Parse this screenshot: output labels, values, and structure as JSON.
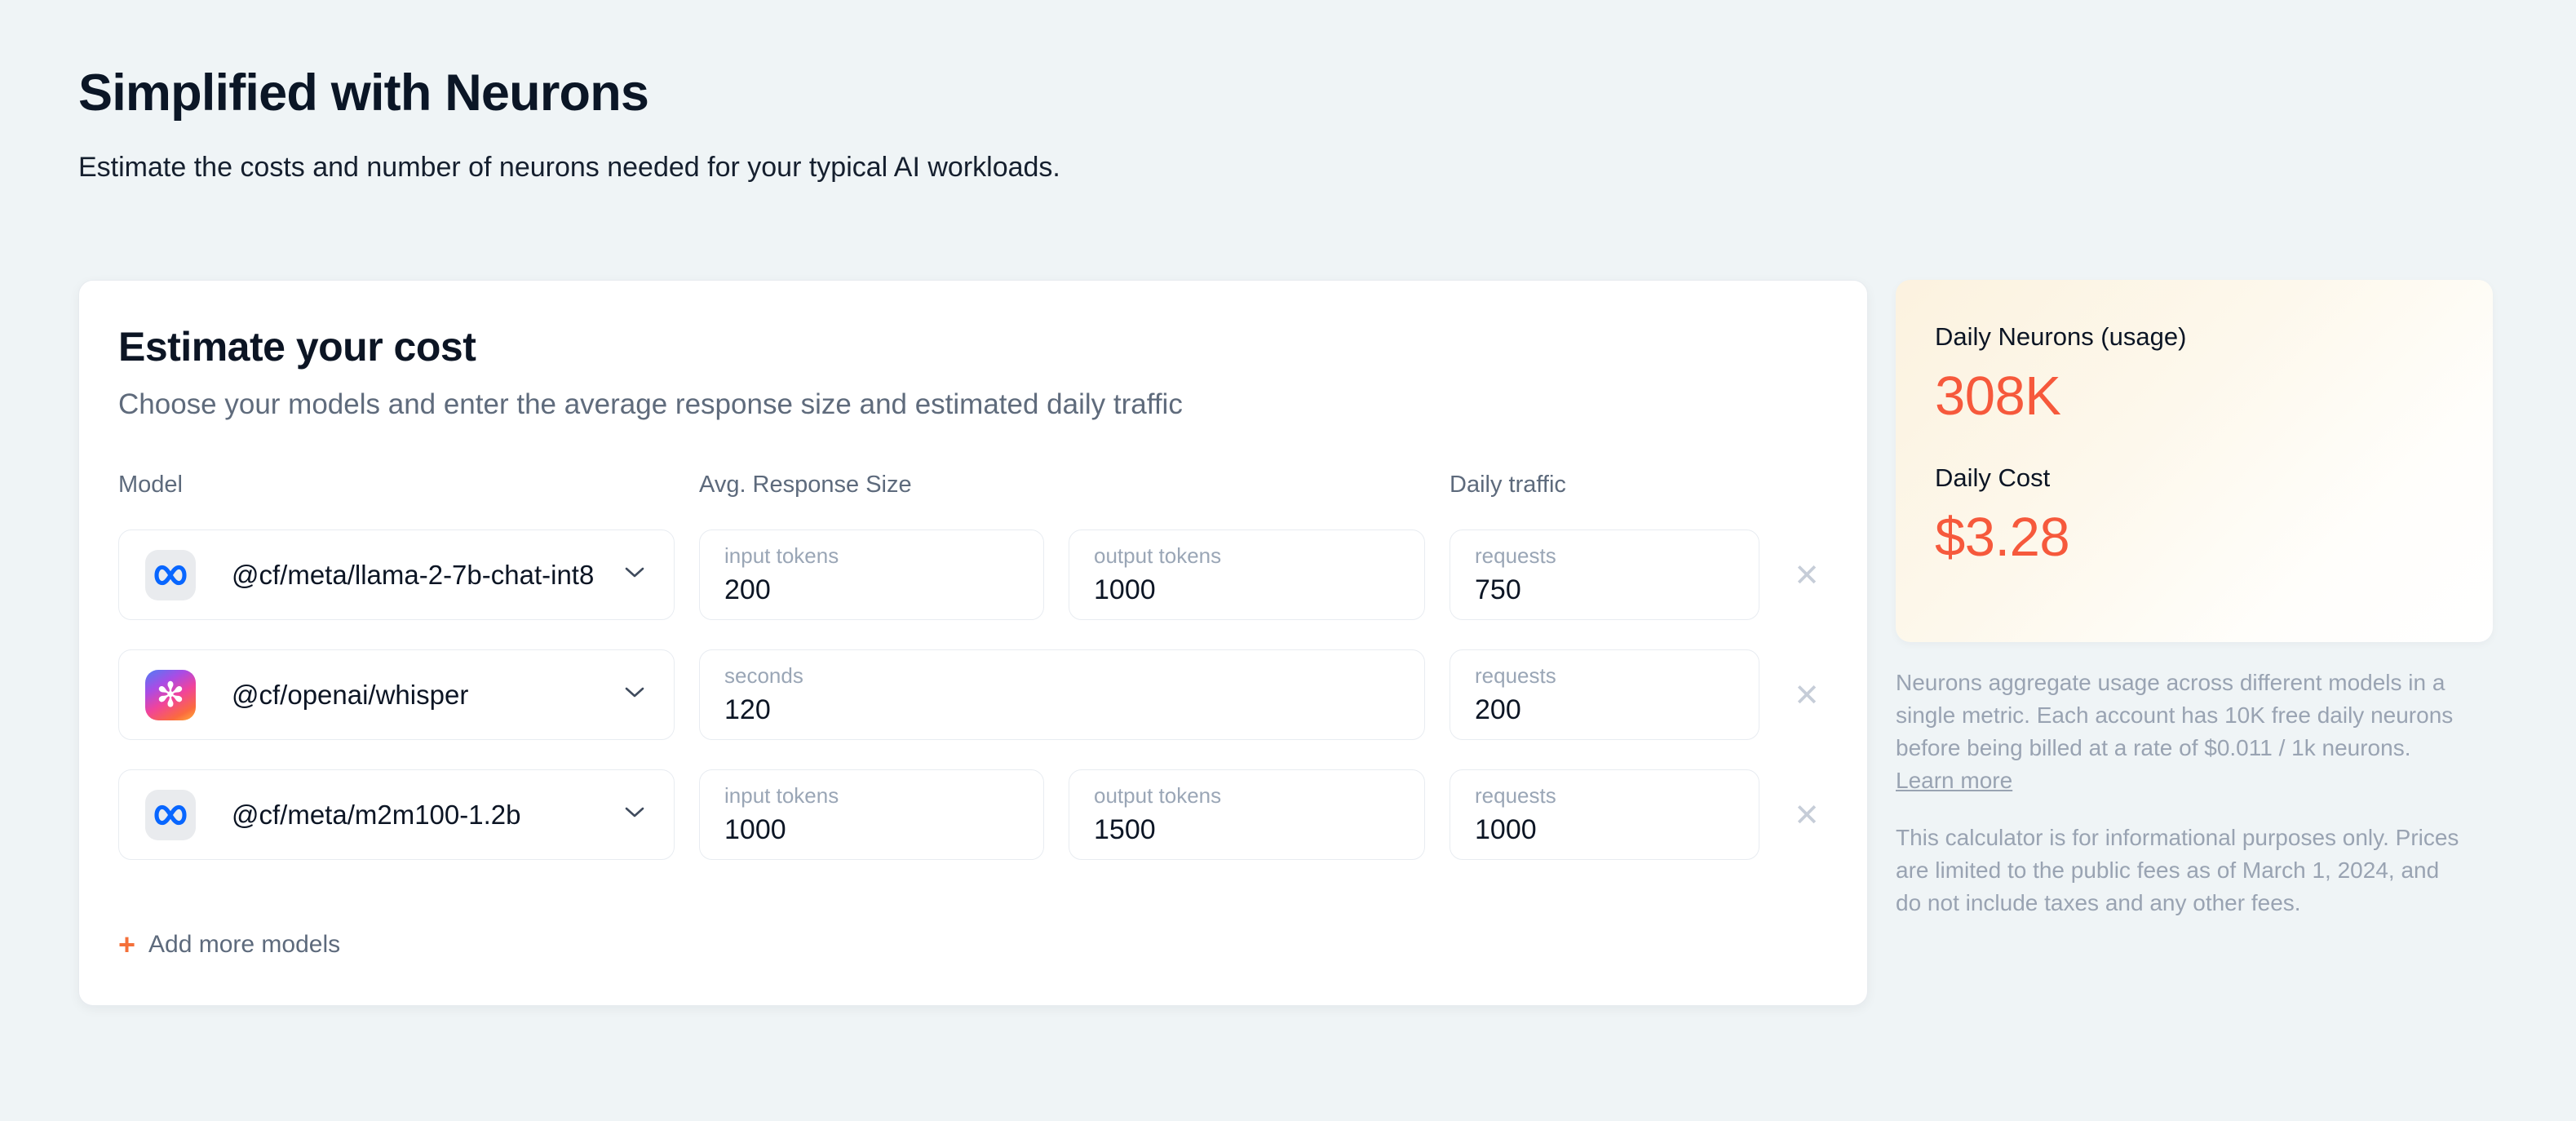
{
  "page": {
    "title": "Simplified with Neurons",
    "subtitle": "Estimate the costs and number of neurons needed for your typical AI workloads."
  },
  "calculator": {
    "title": "Estimate your cost",
    "subtitle": "Choose your models and enter the average response size and estimated daily traffic",
    "columns": {
      "model": "Model",
      "avg_response": "Avg. Response Size",
      "daily_traffic": "Daily traffic"
    },
    "rows": [
      {
        "model": "@cf/meta/llama-2-7b-chat-int8",
        "provider": "meta",
        "fields": [
          {
            "label": "input tokens",
            "value": "200"
          },
          {
            "label": "output tokens",
            "value": "1000"
          }
        ],
        "traffic": {
          "label": "requests",
          "value": "750"
        }
      },
      {
        "model": "@cf/openai/whisper",
        "provider": "openai",
        "fields": [
          {
            "label": "seconds",
            "value": "120"
          }
        ],
        "traffic": {
          "label": "requests",
          "value": "200"
        }
      },
      {
        "model": "@cf/meta/m2m100-1.2b",
        "provider": "meta",
        "fields": [
          {
            "label": "input tokens",
            "value": "1000"
          },
          {
            "label": "output tokens",
            "value": "1500"
          }
        ],
        "traffic": {
          "label": "requests",
          "value": "1000"
        }
      }
    ],
    "add_more_label": "Add more models"
  },
  "summary": {
    "neurons_label": "Daily Neurons (usage)",
    "neurons_value": "308K",
    "cost_label": "Daily Cost",
    "cost_value": "$3.28",
    "note1_text": "Neurons aggregate usage across different models in a single metric. Each account has 10K free daily neurons before being billed at a rate of $0.011 / 1k neurons. ",
    "note1_link": "Learn more",
    "note2": "This calculator is for informational purposes only. Prices are limited to the public fees as of March 1, 2024, and do not include taxes and any other fees."
  },
  "icons": {
    "plus": "+",
    "remove": "✕",
    "openai_glyph": "✻"
  },
  "colors": {
    "accent_orange": "#f6593c",
    "plus_orange": "#f4703a",
    "meta_blue": "#0866ff",
    "page_background": "#eff4f6",
    "summary_cream": "#fcf2df"
  }
}
